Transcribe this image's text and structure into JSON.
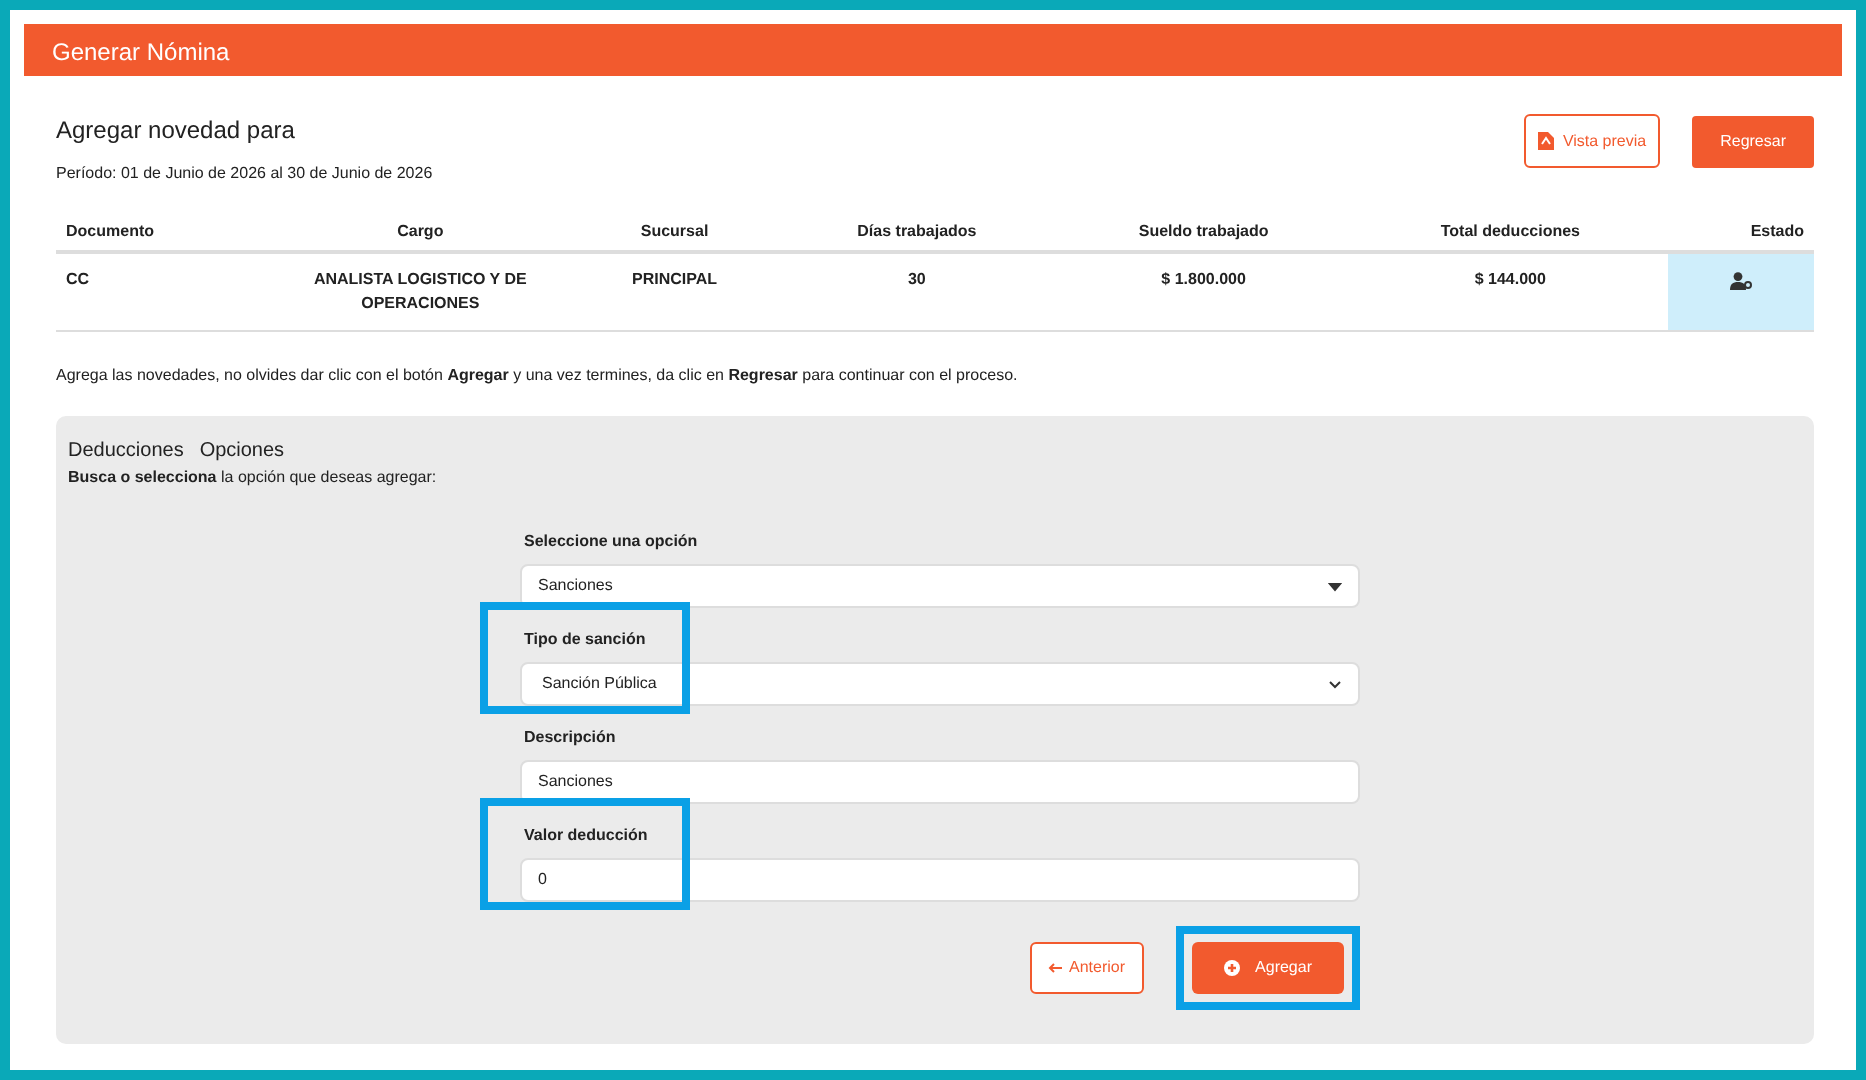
{
  "header": {
    "title": "Generar Nómina"
  },
  "heading": "Agregar novedad para",
  "period": "Período: 01 de Junio de 2026 al 30 de Junio de 2026",
  "buttons": [
    {
      "label": "Vista previa",
      "kind": "outline"
    },
    {
      "label": "Regresar",
      "kind": "solid"
    }
  ],
  "table": {
    "columns": [
      "Documento",
      "Cargo",
      "Sucursal",
      "Días trabajados",
      "Sueldo trabajado",
      "Total deducciones",
      "Estado"
    ],
    "rows": [
      [
        "CC",
        "ANALISTA LOGISTICO Y DE OPERACIONES",
        "PRINCIPAL",
        "30",
        "$ 1.800.000",
        "$ 144.000",
        ""
      ]
    ]
  },
  "instructions": "Agrega las novedades, no olvides dar clic con el botón **Agregar** y una vez termines, da clic en **Regresar** para continuar con el proceso.",
  "form": {
    "breadcrumb": [
      "Deducciones",
      "Opciones"
    ],
    "hint": "**Busca o selecciona** la opción que deseas agregar:",
    "fields": [
      {
        "label": "Seleccione una opción",
        "kind": "select",
        "value": "Sanciones",
        "highlighted": false
      },
      {
        "label": "Tipo de sanción",
        "kind": "select",
        "value": "Sanción Pública",
        "highlighted": true
      },
      {
        "label": "Descripción",
        "kind": "text",
        "value": "Sanciones",
        "highlighted": false
      },
      {
        "label": "Valor deducción",
        "kind": "text",
        "value": "0",
        "highlighted": true
      }
    ],
    "actions": [
      {
        "label": "Anterior",
        "kind": "outline",
        "highlighted": false
      },
      {
        "label": "Agregar",
        "kind": "solid",
        "highlighted": true
      }
    ]
  }
}
